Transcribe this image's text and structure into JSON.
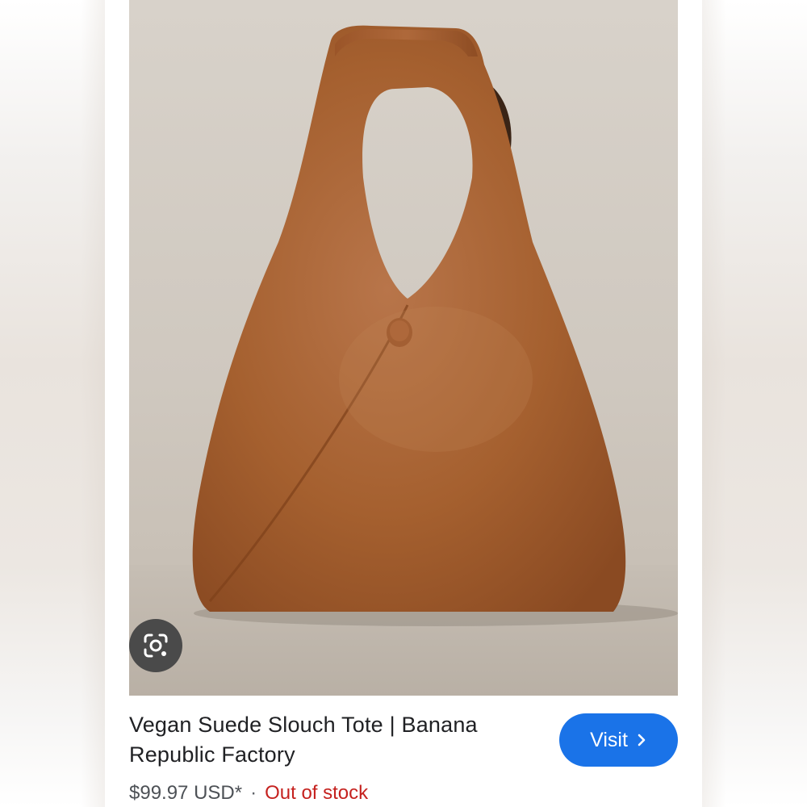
{
  "product": {
    "title": "Vegan Suede Slouch Tote | Banana Republic Factory",
    "price": "$99.97 USD*",
    "separator": "·",
    "stock_status": "Out of stock"
  },
  "actions": {
    "visit_label": "Visit",
    "visit_icon": "chevron-right-icon",
    "lens_icon": "google-lens-icon"
  },
  "colors": {
    "visit_button": "#1a73e8",
    "stock_status": "#c5221f",
    "bag": "#a8633a",
    "photo_background": "#d4cdc5"
  }
}
